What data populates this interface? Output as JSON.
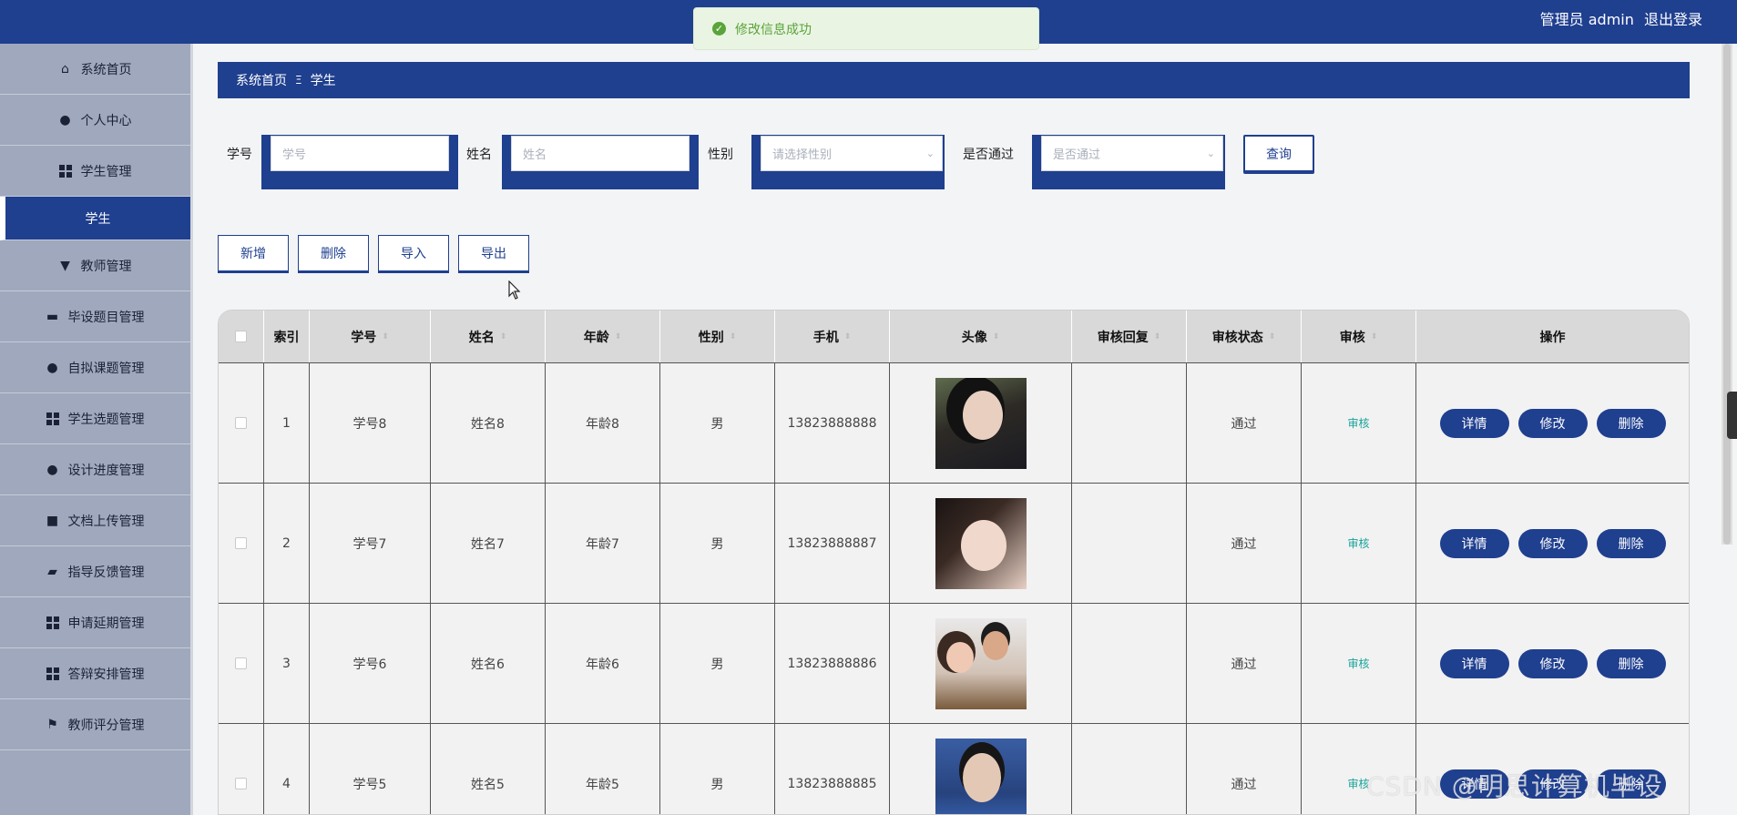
{
  "header": {
    "role": "管理员 admin",
    "logout": "退出登录"
  },
  "toast": {
    "message": "修改信息成功"
  },
  "sidebar": {
    "items": [
      {
        "label": "系统首页",
        "icon": "home-icon"
      },
      {
        "label": "个人中心",
        "icon": "user-icon"
      },
      {
        "label": "学生管理",
        "icon": "grid-icon"
      },
      {
        "label": "学生",
        "icon": ""
      },
      {
        "label": "教师管理",
        "icon": "monitor-icon"
      },
      {
        "label": "毕设题目管理",
        "icon": "desktop-icon"
      },
      {
        "label": "自拟课题管理",
        "icon": "user-icon"
      },
      {
        "label": "学生选题管理",
        "icon": "grid-icon"
      },
      {
        "label": "设计进度管理",
        "icon": "bulb-icon"
      },
      {
        "label": "文档上传管理",
        "icon": "ticket-icon"
      },
      {
        "label": "指导反馈管理",
        "icon": "wallet-icon"
      },
      {
        "label": "申请延期管理",
        "icon": "grid-icon"
      },
      {
        "label": "答辩安排管理",
        "icon": "grid-icon"
      },
      {
        "label": "教师评分管理",
        "icon": "flag-icon"
      }
    ]
  },
  "breadcrumb": {
    "home": "系统首页",
    "sep": "Ξ",
    "current": "学生"
  },
  "search": {
    "fields": [
      {
        "label": "学号",
        "placeholder": "学号"
      },
      {
        "label": "姓名",
        "placeholder": "姓名"
      },
      {
        "label": "性别",
        "placeholder": "请选择性别"
      },
      {
        "label": "是否通过",
        "placeholder": "是否通过"
      }
    ],
    "query": "查询"
  },
  "actions": {
    "add": "新增",
    "delete": "删除",
    "import": "导入",
    "export": "导出"
  },
  "table": {
    "columns": [
      "索引",
      "学号",
      "姓名",
      "年龄",
      "性别",
      "手机",
      "头像",
      "审核回复",
      "审核状态",
      "审核",
      "操作"
    ],
    "rows": [
      {
        "index": "1",
        "sid": "学号8",
        "name": "姓名8",
        "age": "年龄8",
        "gender": "男",
        "phone": "13823888888",
        "reply": "",
        "status": "通过",
        "review": "审核"
      },
      {
        "index": "2",
        "sid": "学号7",
        "name": "姓名7",
        "age": "年龄7",
        "gender": "男",
        "phone": "13823888887",
        "reply": "",
        "status": "通过",
        "review": "审核"
      },
      {
        "index": "3",
        "sid": "学号6",
        "name": "姓名6",
        "age": "年龄6",
        "gender": "男",
        "phone": "13823888886",
        "reply": "",
        "status": "通过",
        "review": "审核"
      },
      {
        "index": "4",
        "sid": "学号5",
        "name": "姓名5",
        "age": "年龄5",
        "gender": "男",
        "phone": "13823888885",
        "reply": "",
        "status": "通过",
        "review": "审核"
      }
    ],
    "ops": {
      "detail": "详情",
      "edit": "修改",
      "delete": "删除"
    }
  },
  "watermark": "CSDN @明思计算机毕设",
  "colors": {
    "primary": "#1f3f8f",
    "sidebar": "#9fa8bd",
    "success": "#5aa43a",
    "link": "#1aa39a"
  }
}
